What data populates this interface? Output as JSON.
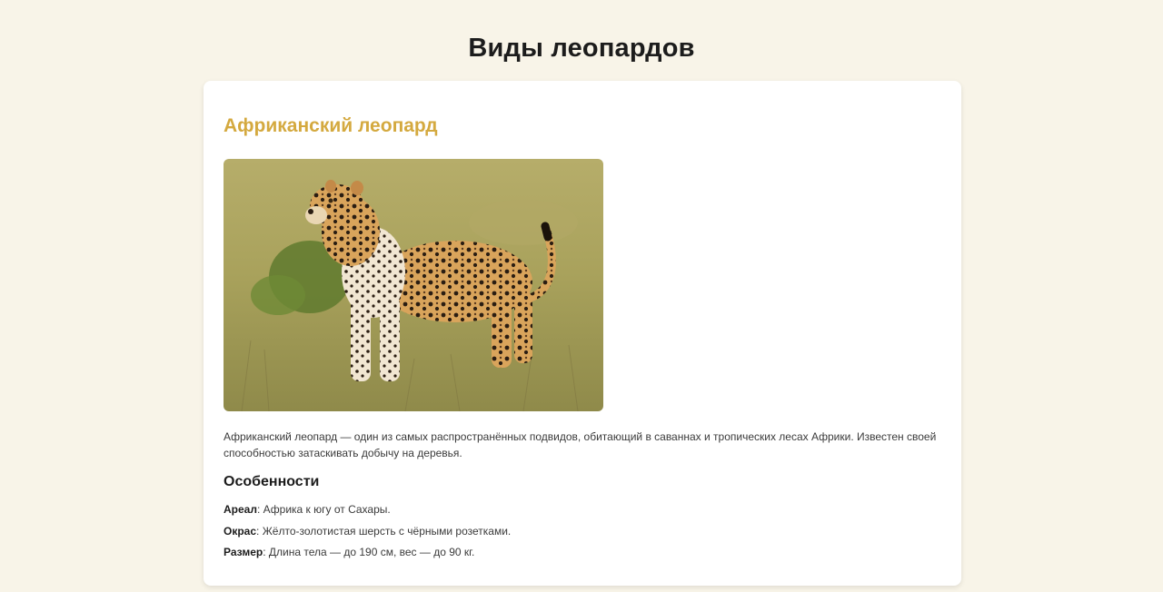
{
  "page": {
    "title": "Виды леопардов"
  },
  "card": {
    "title": "Африканский леопард",
    "image_alt": "Африканский леопард",
    "description": "Африканский леопард — один из самых распространённых подвидов, обитающий в саваннах и тропических лесах Африки. Известен своей способностью затаскивать добычу на деревья.",
    "features_heading": "Особенности",
    "features": [
      {
        "label": "Ареал",
        "value": ": Африка к югу от Сахары."
      },
      {
        "label": "Окрас",
        "value": ": Жёлто-золотистая шерсть с чёрными розетками."
      },
      {
        "label": "Размер",
        "value": ": Длина тела — до 190 см, вес — до 90 кг."
      }
    ]
  },
  "colors": {
    "page_background": "#f8f4e8",
    "card_background": "#ffffff",
    "accent_title": "#d4a93f",
    "text_dark": "#1c1c1c",
    "text_body": "#3a3a3a"
  }
}
